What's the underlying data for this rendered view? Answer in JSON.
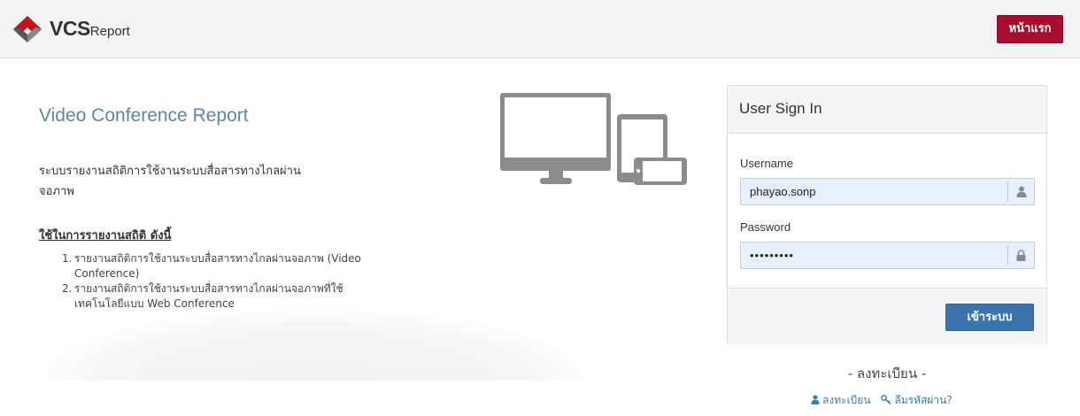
{
  "header": {
    "logo_icon": "vcs-diamond-logo-icon",
    "brand_primary": "VCS",
    "brand_secondary": "Report",
    "home_button": "หน้าแรก",
    "accent_color": "#a50f2d"
  },
  "main": {
    "title": "Video Conference Report",
    "description": "ระบบรายงานสถิติการใช้งานระบบสื่อสารทางไกลผ่านจอภาพ",
    "usage_heading": "ใช้ในการรายงานสถิติ ดังนี้",
    "usage_items": [
      {
        "num": "1.",
        "text": "รายงานสถิติการใช้งานระบบสื่อสารทางไกลผ่านจอภาพ (Video Conference)"
      },
      {
        "num": "2.",
        "text": "รายงานสถิติการใช้งานระบบสื่อสารทางไกลผ่านจอภาพที่ใช้เทคโนโลยีแบบ Web Conference"
      }
    ],
    "illustration_icon": "devices-icon"
  },
  "login": {
    "panel_title": "User Sign In",
    "username_label": "Username",
    "username_value": "phayao.sonp",
    "username_icon": "user-icon",
    "password_label": "Password",
    "password_value": "•••••••••",
    "password_icon": "lock-icon",
    "submit_button": "เข้าระบบ",
    "button_color": "#3a74ab"
  },
  "register": {
    "heading": "- ลงทะเบียน -",
    "register_link": "ลงทะเบียน",
    "forgot_link": "ลืมรหัสผ่าน?"
  }
}
